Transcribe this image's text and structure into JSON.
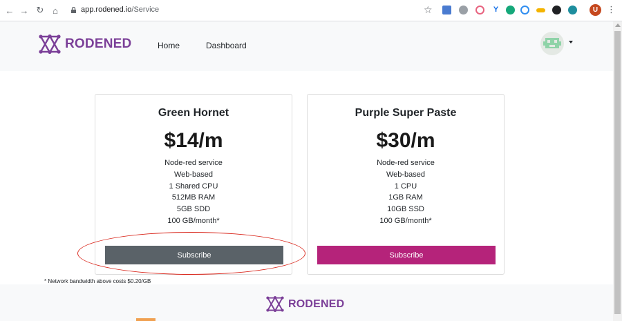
{
  "browser": {
    "url_host": "app.rodened.io",
    "url_path": "/Service",
    "profile_initial": "U"
  },
  "header": {
    "brand": "RODENED",
    "nav": [
      "Home",
      "Dashboard"
    ]
  },
  "plans": [
    {
      "name": "Green Hornet",
      "price": "$14/m",
      "features": [
        "Node-red service",
        "Web-based",
        "1 Shared CPU",
        "512MB RAM",
        "5GB SDD",
        "100 GB/month*"
      ],
      "button": "Subscribe",
      "button_color": "#5a6268"
    },
    {
      "name": "Purple Super Paste",
      "price": "$30/m",
      "features": [
        "Node-red service",
        "Web-based",
        "1 CPU",
        "1GB RAM",
        "10GB SSD",
        "100 GB/month*"
      ],
      "button": "Subscribe",
      "button_color": "#b5237a"
    }
  ],
  "footnote": "* Network bandwidth above costs $0.20/GB",
  "footer": {
    "brand": "RODENED"
  },
  "colors": {
    "brand": "#7b3f98",
    "annotation": "#d9271c"
  }
}
